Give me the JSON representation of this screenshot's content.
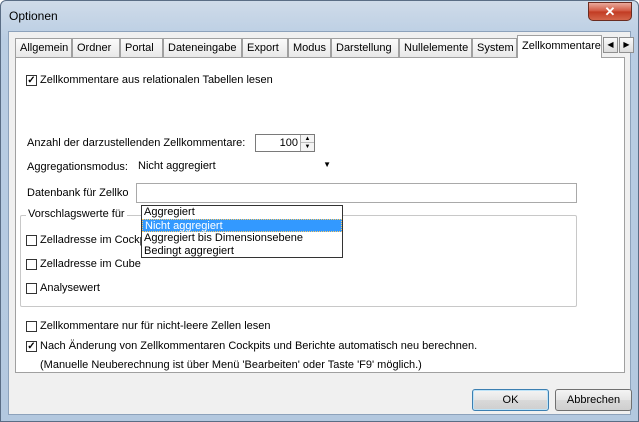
{
  "window": {
    "title": "Optionen",
    "close_glyph": "✕"
  },
  "tabs": [
    {
      "label": "Allgemein"
    },
    {
      "label": "Ordner"
    },
    {
      "label": "Portal"
    },
    {
      "label": "Dateneingabe"
    },
    {
      "label": "Export"
    },
    {
      "label": "Modus"
    },
    {
      "label": "Darstellung"
    },
    {
      "label": "Nullelemente"
    },
    {
      "label": "System"
    },
    {
      "label": "Zellkommentare"
    }
  ],
  "tab_scroll": {
    "left": "◀",
    "right": "▶"
  },
  "panel": {
    "relational_checkbox": {
      "label": "Zellkommentare aus relationalen Tabellen lesen",
      "checked": true,
      "mark": "✓"
    },
    "count": {
      "label": "Anzahl der darzustellenden Zellkommentare:",
      "value": "100"
    },
    "aggregation": {
      "label": "Aggregationsmodus:",
      "selected": "Nicht aggregiert",
      "options": [
        "Aggregiert",
        "Nicht aggregiert",
        "Aggregiert bis Dimensionsebene",
        "Bedingt aggregiert"
      ]
    },
    "database": {
      "label": "Datenbank für Zellko"
    },
    "suggestions": {
      "title": "Vorschlagswerte für",
      "items": [
        {
          "label": "Zelladresse im Cockpit",
          "checked": false
        },
        {
          "label": "Zelladresse im Cube",
          "checked": false
        },
        {
          "label": "Analysewert",
          "checked": false
        }
      ]
    },
    "nonempty_checkbox": {
      "label": "Zellkommentare nur für nicht-leere Zellen lesen",
      "checked": false
    },
    "recalc_checkbox": {
      "label": "Nach Änderung von Zellkommentaren Cockpits und Berichte automatisch neu berechnen.",
      "checked": true,
      "mark": "✓"
    },
    "recalc_note": "(Manuelle Neuberechnung ist über Menü 'Bearbeiten' oder Taste 'F9' möglich.)"
  },
  "buttons": {
    "ok": "OK",
    "cancel": "Abbrechen"
  }
}
